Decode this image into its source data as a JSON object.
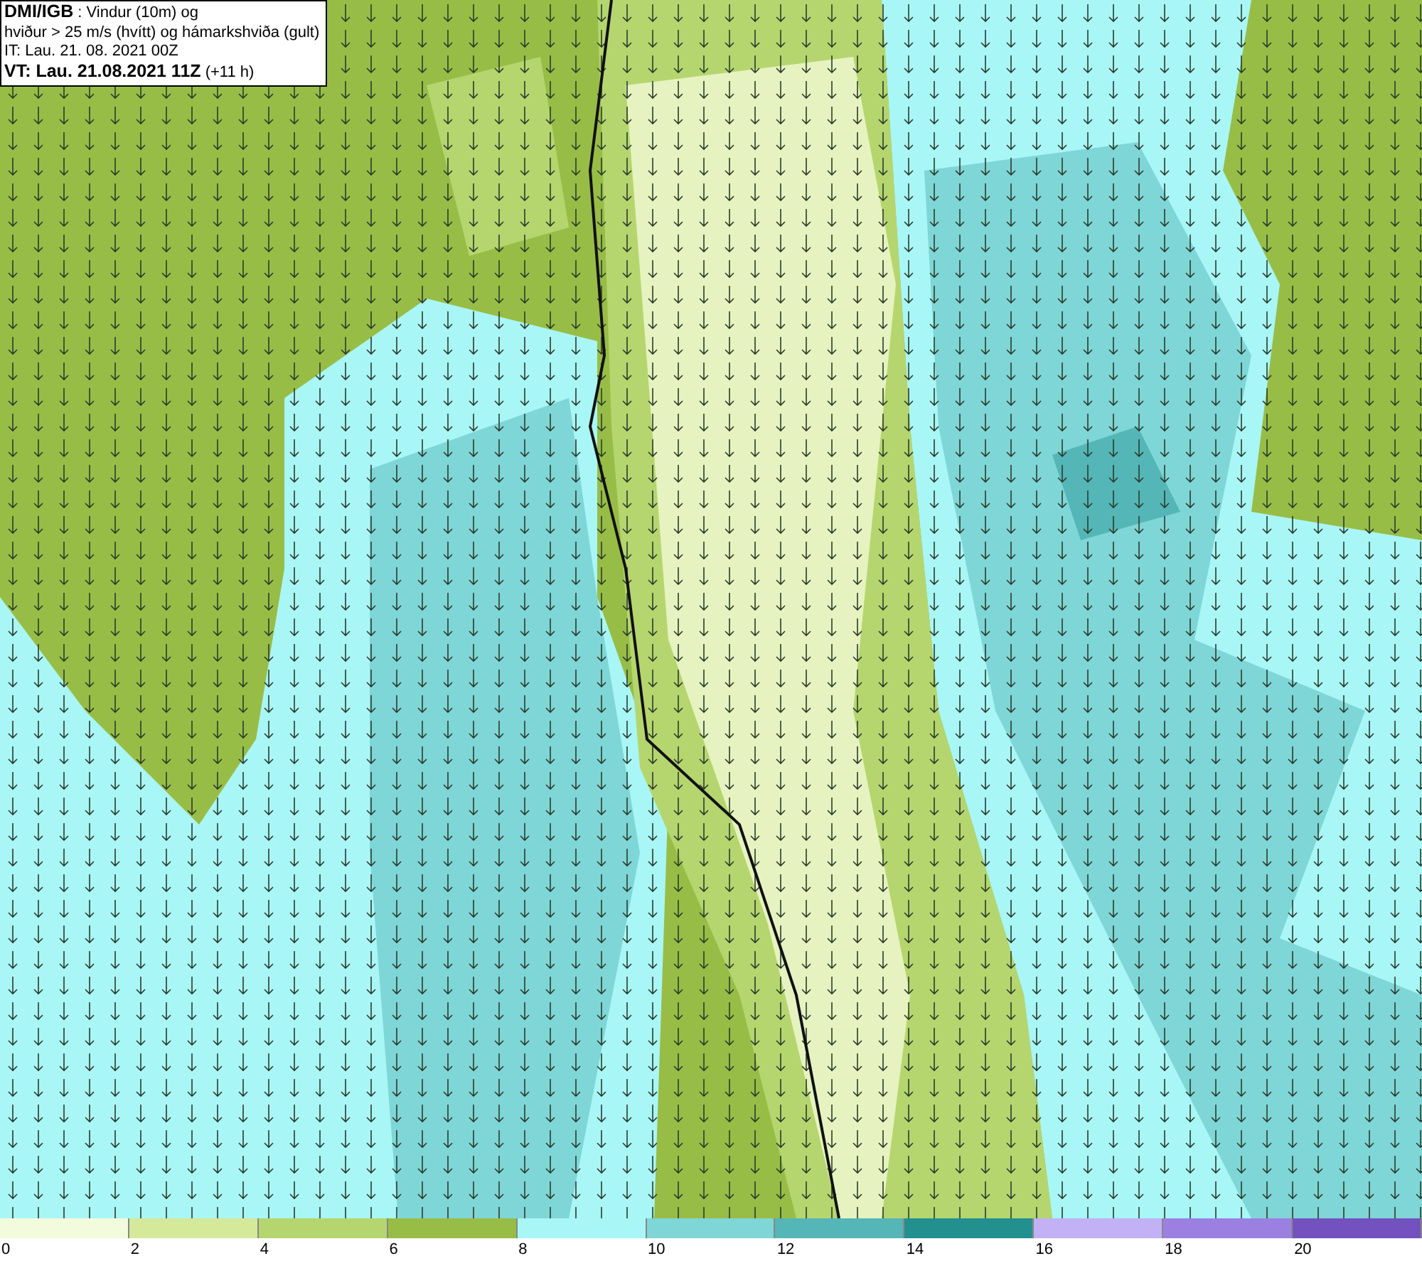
{
  "legend": {
    "lines": [
      "**DMI/IGB** : Vindur (10m) og",
      "hviður > 25 m/s (hvítt) og hámarkshviða (gult)",
      "IT: Lau. 21. 08. 2021 00Z",
      "**VT: Lau. 21.08.2021 11Z** (+11 h)"
    ]
  },
  "scale": [
    {
      "label": "0",
      "color": "#f2fbdc"
    },
    {
      "label": "2",
      "color": "#d4e99a"
    },
    {
      "label": "4",
      "color": "#b5d66e"
    },
    {
      "label": "6",
      "color": "#98bd46"
    },
    {
      "label": "8",
      "color": "#a9f6f6"
    },
    {
      "label": "10",
      "color": "#7fd6d6"
    },
    {
      "label": "12",
      "color": "#54b6b6"
    },
    {
      "label": "14",
      "color": "#239090"
    },
    {
      "label": "16",
      "color": "#c2b1f4"
    },
    {
      "label": "18",
      "color": "#9b80e2"
    },
    {
      "label": "20",
      "color": "#7352c0"
    }
  ]
}
